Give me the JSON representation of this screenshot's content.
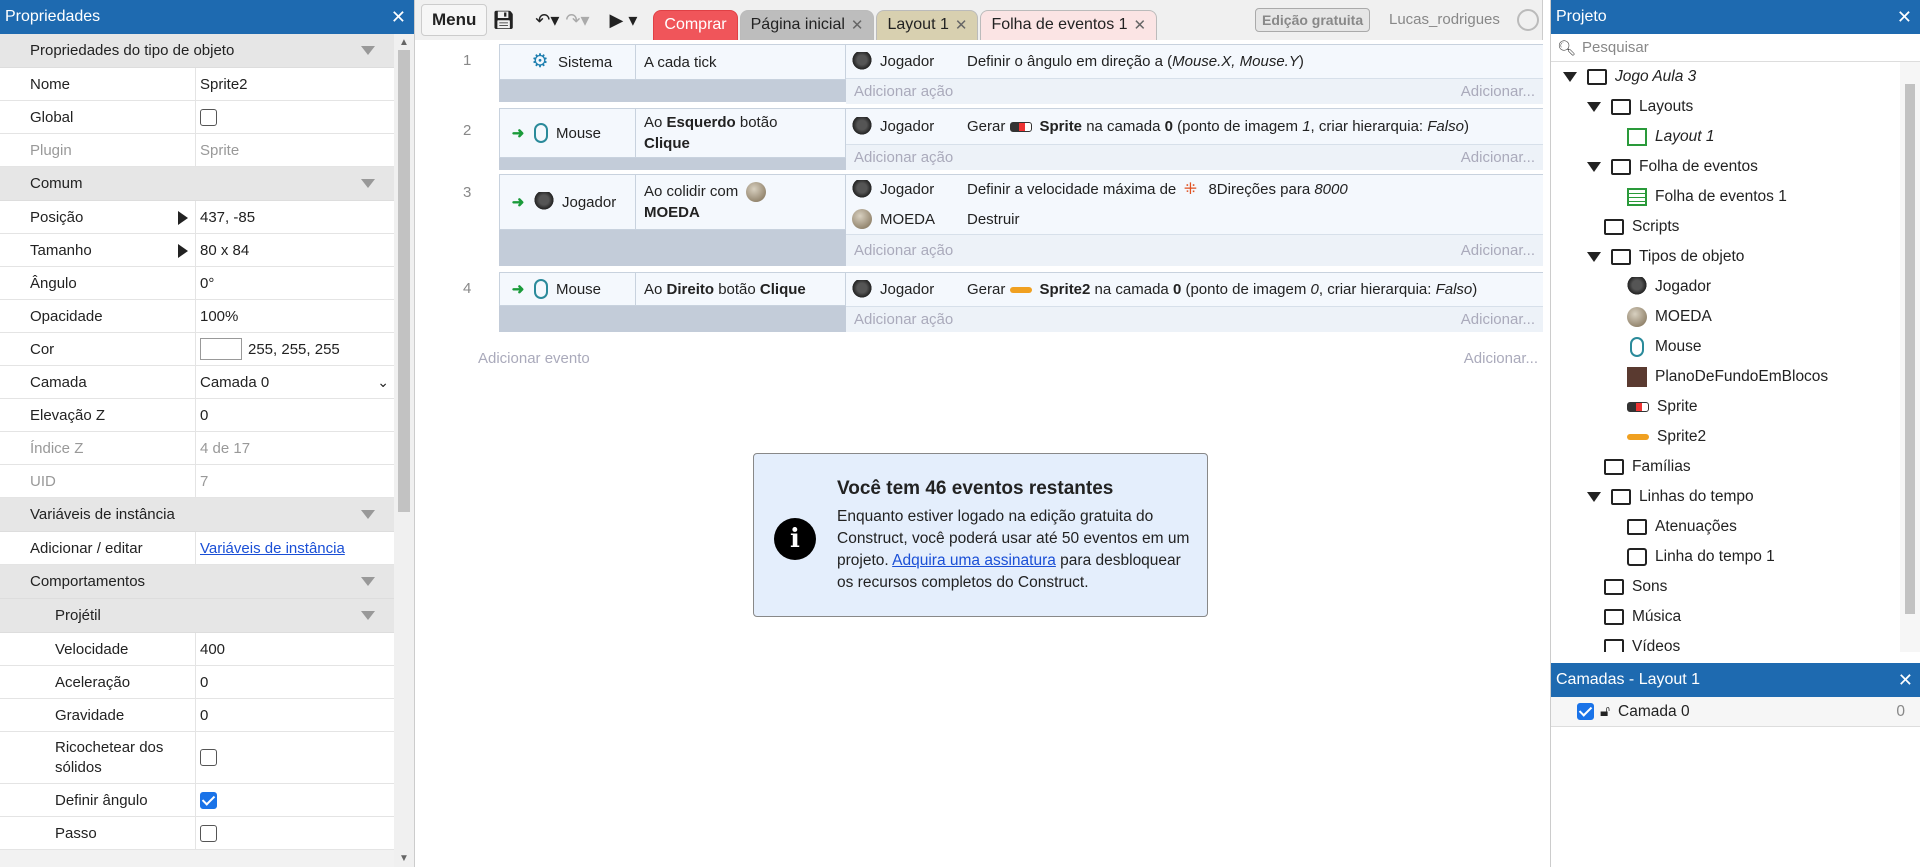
{
  "left": {
    "title": "Propriedades",
    "sections": {
      "object_type": "Propriedades do tipo de objeto",
      "common": "Comum",
      "instance_vars": "Variáveis de instância",
      "behaviors": "Comportamentos",
      "projectile": "Projétil"
    },
    "name": {
      "label": "Nome",
      "value": "Sprite2"
    },
    "global": {
      "label": "Global"
    },
    "plugin": {
      "label": "Plugin",
      "value": "Sprite"
    },
    "position": {
      "label": "Posição",
      "value": "437, -85"
    },
    "size": {
      "label": "Tamanho",
      "value": "80  x 84"
    },
    "angle": {
      "label": "Ângulo",
      "value": "0°"
    },
    "opacity": {
      "label": "Opacidade",
      "value": "100%"
    },
    "color": {
      "label": "Cor",
      "value": "255, 255, 255"
    },
    "layer": {
      "label": "Camada",
      "value": "Camada 0"
    },
    "z_elev": {
      "label": "Elevação Z",
      "value": "0"
    },
    "z_index": {
      "label": "Índice Z",
      "value": "4 de 17"
    },
    "uid": {
      "label": "UID",
      "value": "7"
    },
    "add_edit": {
      "label": "Adicionar / editar",
      "link": "Variáveis de instância"
    },
    "speed": {
      "label": "Velocidade",
      "value": "400"
    },
    "accel": {
      "label": "Aceleração",
      "value": "0"
    },
    "gravity": {
      "label": "Gravidade",
      "value": "0"
    },
    "bounce": {
      "label": "Ricochetear dos sólidos"
    },
    "set_angle": {
      "label": "Definir ângulo"
    },
    "step": {
      "label": "Passo"
    }
  },
  "toolbar": {
    "menu": "Menu",
    "tabs": [
      {
        "label": "Comprar"
      },
      {
        "label": "Página inicial"
      },
      {
        "label": "Layout 1"
      },
      {
        "label": "Folha de eventos 1"
      }
    ],
    "free_edition": "Edição gratuita",
    "user": "Lucas_rodrigues"
  },
  "events": [
    {
      "num": "1",
      "obj": "Sistema",
      "cond": "A cada tick",
      "actions": [
        {
          "obj": "Jogador",
          "pre": "Definir o ângulo em direção a (",
          "it": "Mouse.X, Mouse.Y",
          "post": ")"
        }
      ]
    },
    {
      "num": "2",
      "obj": "Mouse",
      "cond_a": "Ao ",
      "cond_b": "Esquerdo",
      "cond_c": " botão ",
      "cond_d": "Clique",
      "actions": [
        {
          "obj": "Jogador",
          "t1": "Gerar ",
          "b1": "Sprite",
          "t2": " na camada ",
          "b2": "0",
          "t3": " (ponto de imagem ",
          "i1": "1",
          "t4": ", criar hierarquia: ",
          "i2": "Falso",
          "t5": ")"
        }
      ]
    },
    {
      "num": "3",
      "obj": "Jogador",
      "cond_a": "Ao colidir com ",
      "cond_b": "MOEDA",
      "actions": [
        {
          "obj": "Jogador",
          "t1": "Definir a velocidade máxima de ",
          "t2": "8Direções para ",
          "i1": "8000"
        },
        {
          "obj": "MOEDA",
          "t1": "Destruir"
        }
      ]
    },
    {
      "num": "4",
      "obj": "Mouse",
      "cond_a": "Ao ",
      "cond_b": "Direito",
      "cond_c": " botão ",
      "cond_d": "Clique",
      "actions": [
        {
          "obj": "Jogador",
          "t1": "Gerar ",
          "b1": "Sprite2",
          "t2": " na camada ",
          "b2": "0",
          "t3": " (ponto de imagem ",
          "i1": "0",
          "t4": ", criar hierarquia: ",
          "i2": "Falso",
          "t5": ")"
        }
      ]
    }
  ],
  "add_action": "Adicionar ação",
  "add_short": "Adicionar...",
  "add_event": "Adicionar evento",
  "notice": {
    "title": "Você tem 46 eventos restantes",
    "body1": "Enquanto estiver logado na edição gratuita do Construct, você poderá usar até 50 eventos em um projeto. ",
    "link": "Adquira uma assinatura",
    "body2": " para desbloquear os recursos completos do Construct."
  },
  "project": {
    "title": "Projeto",
    "search_placeholder": "Pesquisar",
    "root": "Jogo Aula 3",
    "items": {
      "layouts": "Layouts",
      "layout1": "Layout 1",
      "sheets": "Folha de eventos",
      "sheet1": "Folha de eventos 1",
      "scripts": "Scripts",
      "types": "Tipos de objeto",
      "jogador": "Jogador",
      "moeda": "MOEDA",
      "mouse": "Mouse",
      "plano": "PlanoDeFundoEmBlocos",
      "sprite": "Sprite",
      "sprite2": "Sprite2",
      "families": "Famílias",
      "timelines": "Linhas do tempo",
      "easings": "Atenuações",
      "timeline1": "Linha do tempo 1",
      "sounds": "Sons",
      "music": "Música",
      "videos": "Vídeos"
    }
  },
  "layers": {
    "title": "Camadas - Layout 1",
    "layer": "Camada 0",
    "count": "0"
  },
  "colors": {
    "accent": "#1e6ab0",
    "comprar": "#f0555a",
    "tab_layout": "#d8d0b0",
    "tab_sheet": "#f6d8d8"
  }
}
